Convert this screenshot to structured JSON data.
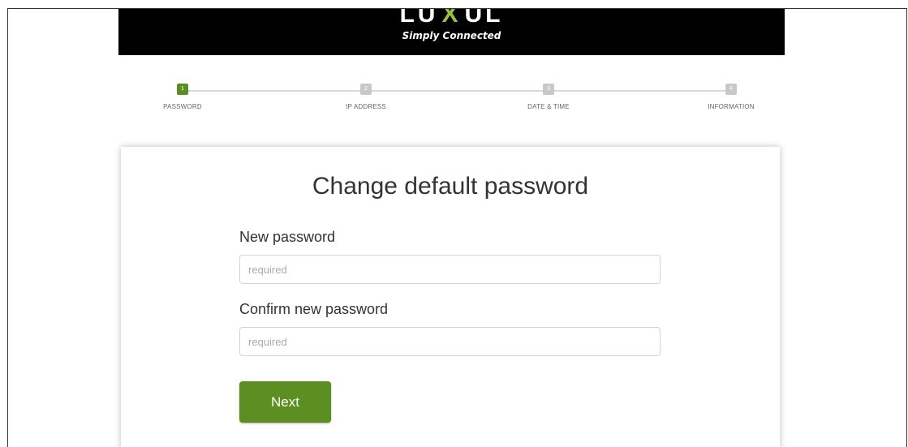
{
  "header": {
    "logo_text_left": "LU",
    "logo_text_x": "X",
    "logo_text_right": "UL",
    "tagline": "Simply Connected"
  },
  "stepper": {
    "steps": [
      {
        "number": "1",
        "label": "PASSWORD",
        "active": true
      },
      {
        "number": "2",
        "label": "IP ADDRESS",
        "active": false
      },
      {
        "number": "3",
        "label": "DATE & TIME",
        "active": false
      },
      {
        "number": "4",
        "label": "INFORMATION",
        "active": false
      }
    ]
  },
  "form": {
    "title": "Change default password",
    "new_password_label": "New password",
    "new_password_placeholder": "required",
    "confirm_password_label": "Confirm new password",
    "confirm_password_placeholder": "required",
    "next_label": "Next"
  },
  "colors": {
    "accent": "#5b8f22",
    "header_bg": "#000000",
    "inactive_step": "#c8c8c8"
  }
}
